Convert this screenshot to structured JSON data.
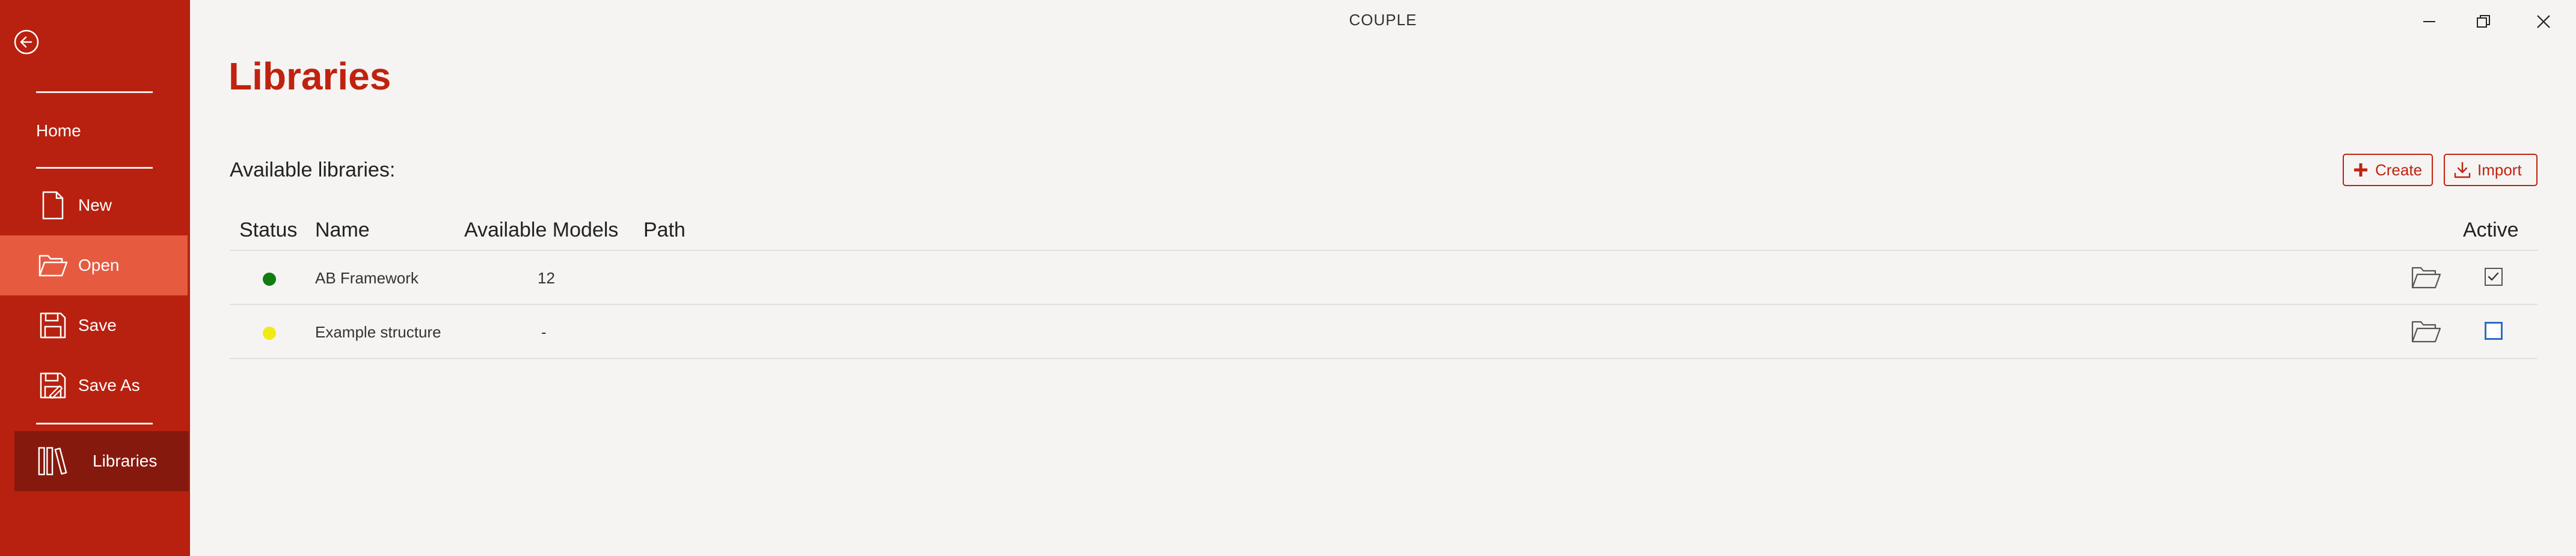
{
  "app": {
    "title": "COUPLE"
  },
  "sidebar": {
    "items": [
      {
        "label": "Home",
        "icon": "home"
      },
      {
        "label": "New",
        "icon": "new-file-icon"
      },
      {
        "label": "Open",
        "icon": "folder-open-icon"
      },
      {
        "label": "Save",
        "icon": "save-icon"
      },
      {
        "label": "Save As",
        "icon": "save-as-icon"
      },
      {
        "label": "Libraries",
        "icon": "libraries-icon"
      }
    ],
    "active": "Libraries",
    "colors": {
      "background": "#b8210f",
      "open_highlight": "#e65a40",
      "active_item": "#86190d"
    }
  },
  "main": {
    "title": "Libraries",
    "section_label": "Available libraries:",
    "buttons": {
      "create": "Create",
      "import": "Import"
    },
    "table": {
      "columns": [
        "Status",
        "Name",
        "Available Models",
        "Path",
        "Active"
      ],
      "rows": [
        {
          "status_color": "#0f7d0f",
          "name": "AB Framework",
          "models": "12",
          "path": "",
          "active": true
        },
        {
          "status_color": "#f2ea14",
          "name": "Example structure",
          "models": "-",
          "path": "",
          "active": false
        }
      ]
    }
  },
  "accent_color": "#c0220f"
}
